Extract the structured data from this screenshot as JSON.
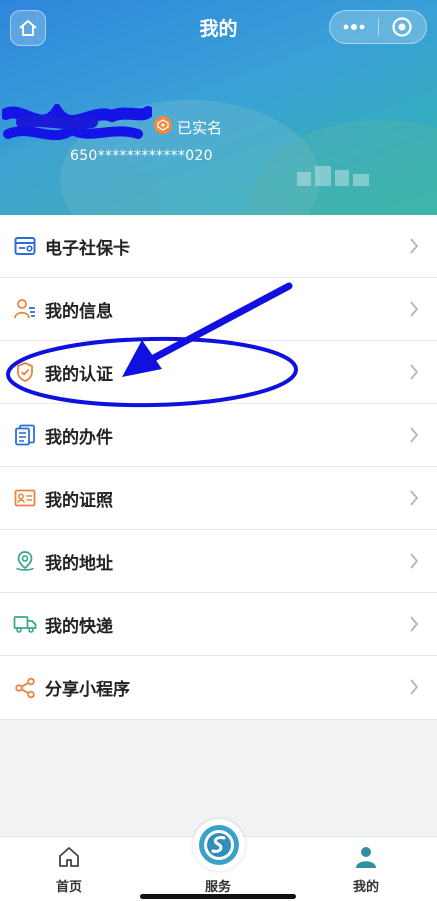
{
  "navbar": {
    "title": "我的"
  },
  "profile": {
    "verified_label": "已实名",
    "id_number": "650************020"
  },
  "menu": {
    "items": [
      {
        "label": "电子社保卡",
        "icon": "social-security-card-icon"
      },
      {
        "label": "我的信息",
        "icon": "user-info-icon"
      },
      {
        "label": "我的认证",
        "icon": "shield-check-icon"
      },
      {
        "label": "我的办件",
        "icon": "documents-icon"
      },
      {
        "label": "我的证照",
        "icon": "id-card-icon"
      },
      {
        "label": "我的地址",
        "icon": "location-pin-icon"
      },
      {
        "label": "我的快递",
        "icon": "delivery-truck-icon"
      },
      {
        "label": "分享小程序",
        "icon": "share-icon"
      }
    ]
  },
  "tabbar": {
    "home_label": "首页",
    "service_label": "服务",
    "mine_label": "我的"
  },
  "colors": {
    "header_blue": "#2e86db",
    "header_teal": "#2fb6a8",
    "icon_blue": "#2d6fd6",
    "icon_orange": "#e8853a",
    "icon_green": "#3aa68a",
    "annotation_blue": "#1010e0",
    "active_tab": "#2f8fa0"
  }
}
